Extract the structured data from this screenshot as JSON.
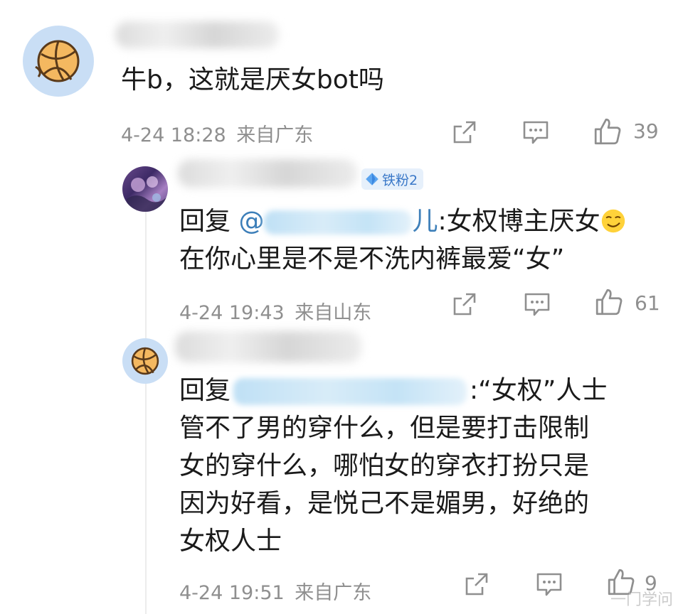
{
  "comments": [
    {
      "text": "牛b，这就是厌女bot吗",
      "time": "4-24 18:28",
      "location": "来自广东",
      "likes": "39"
    },
    {
      "badge": "铁粉2",
      "reply_prefix": "回复 ",
      "mention_at": "@",
      "mention_tail": "儿",
      "reply_text_line1": ":女权博主厌女",
      "reply_text_line2": "在你心里是不是不洗内裤最爱“女”",
      "time": "4-24 19:43",
      "location": "来自山东",
      "likes": "61"
    },
    {
      "reply_prefix": "回复",
      "after_mention": ":“女权”人士",
      "lines": [
        "管不了男的穿什么，但是要打击限制",
        "女的穿什么，哪怕女的穿衣打扮只是",
        "因为好看，是悦己不是媚男，好绝的",
        "女权人士"
      ],
      "time": "4-24 19:51",
      "location": "来自广东",
      "likes": "9"
    }
  ],
  "watermark": "一门学问",
  "colors": {
    "mention": "#3d7fb9",
    "meta": "#8f8f8f",
    "badge_bg": "#e6f0fb"
  }
}
